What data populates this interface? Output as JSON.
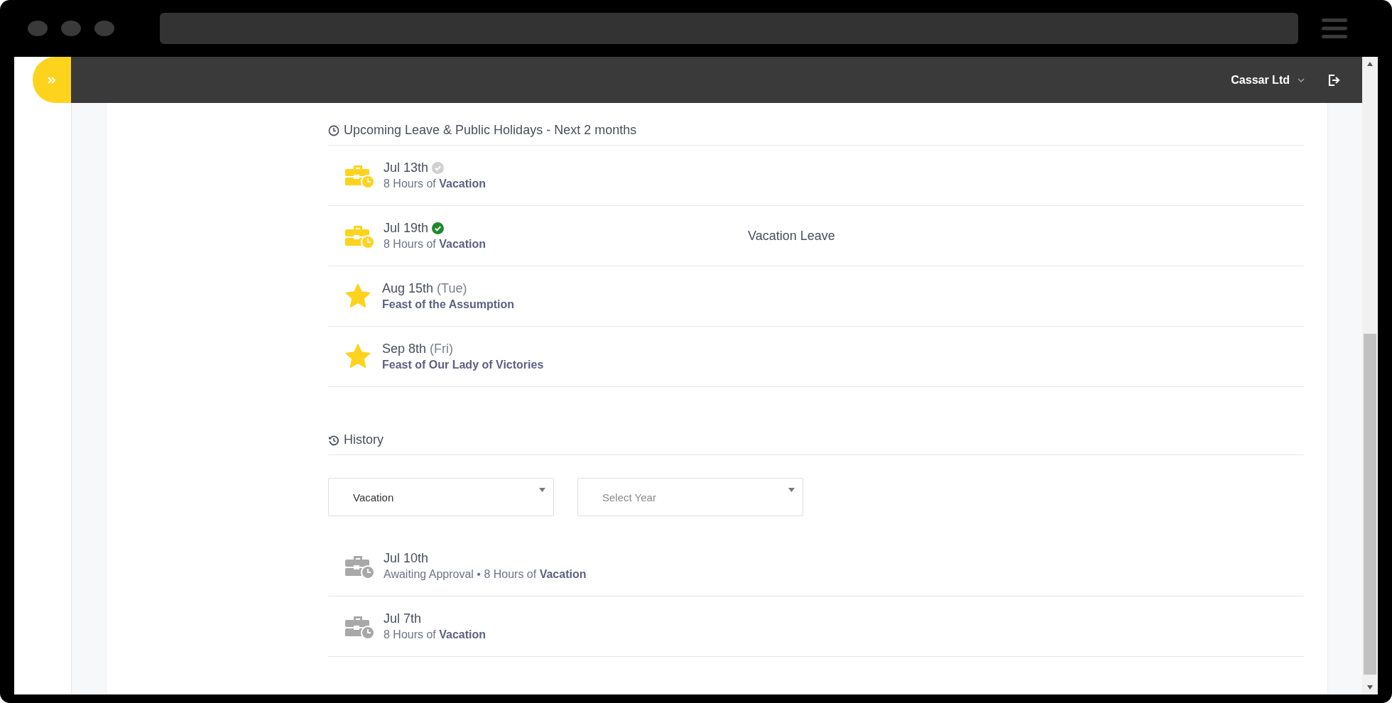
{
  "header": {
    "company": "Cassar Ltd"
  },
  "upcoming": {
    "title": "Upcoming Leave & Public Holidays - Next 2 months",
    "rows": [
      {
        "kind": "leave",
        "date": "Jul 13th",
        "approved": false,
        "detail": "8 Hours of **Vacation**"
      },
      {
        "kind": "leave",
        "date": "Jul 19th",
        "approved": true,
        "detail": "8 Hours of **Vacation**",
        "note": "Vacation Leave"
      },
      {
        "kind": "holiday",
        "date": "Aug 15th",
        "day": "(Tue)",
        "detail": "Feast of the Assumption"
      },
      {
        "kind": "holiday",
        "date": "Sep 8th",
        "day": "(Fri)",
        "detail": "Feast of Our Lady of Victories"
      }
    ]
  },
  "history": {
    "title": "History",
    "filters": [
      {
        "value": "Vacation"
      },
      {
        "placeholder": "Select Year"
      }
    ],
    "rows": [
      {
        "kind": "leave",
        "date": "Jul 10th",
        "detail": "Awaiting Approval • 8 Hours of **Vacation**"
      },
      {
        "kind": "leave",
        "date": "Jul 7th",
        "detail": "8 Hours of **Vacation**"
      }
    ]
  }
}
